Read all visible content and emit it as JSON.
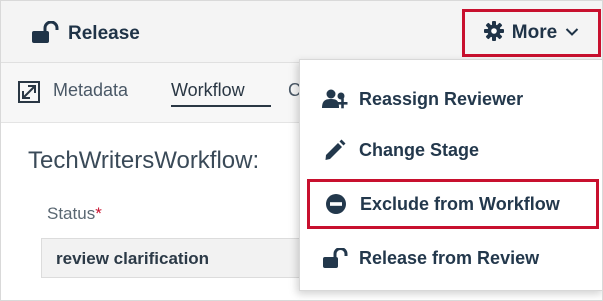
{
  "toolbar": {
    "release_label": "Release",
    "more_label": "More"
  },
  "tabs": {
    "metadata_label": "Metadata",
    "workflow_label": "Workflow",
    "truncated_label": "C"
  },
  "content": {
    "workflow_title": "TechWritersWorkflow:",
    "status_label": "Status",
    "required_marker": "*",
    "status_value": "review clarification"
  },
  "menu": {
    "items": [
      {
        "label": "Reassign Reviewer",
        "icon": "user-plus-icon"
      },
      {
        "label": "Change Stage",
        "icon": "pencil-icon"
      },
      {
        "label": "Exclude from Workflow",
        "icon": "minus-circle-icon"
      },
      {
        "label": "Release from Review",
        "icon": "unlock-icon"
      }
    ]
  },
  "colors": {
    "highlight": "#c8102e",
    "text_dark": "#23384c",
    "toolbar_bg": "#f4f4f4"
  }
}
